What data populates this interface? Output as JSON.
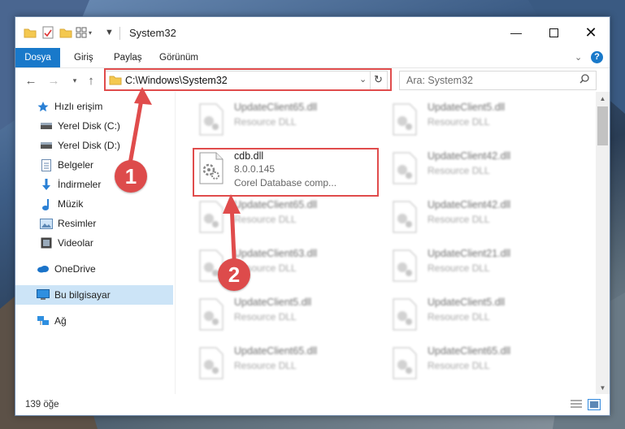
{
  "window": {
    "title": "System32"
  },
  "ribbon": {
    "tabs": [
      "Dosya",
      "Giriş",
      "Paylaş",
      "Görünüm"
    ]
  },
  "address": {
    "path": "C:\\Windows\\System32"
  },
  "search": {
    "placeholder": "Ara: System32"
  },
  "nav": {
    "quick_access": "Hızlı erişim",
    "items": [
      "Yerel Disk (C:)",
      "Yerel Disk (D:)",
      "Belgeler",
      "İndirmeler",
      "Müzik",
      "Resimler",
      "Videolar"
    ],
    "onedrive": "OneDrive",
    "this_pc": "Bu bilgisayar",
    "network": "Ağ"
  },
  "files": {
    "left": [
      {
        "name": "UpdateClient65.dll",
        "type": "Resource DLL"
      },
      {
        "name": "cdb.dll",
        "version": "8.0.0.145",
        "desc": "Corel Database comp..."
      },
      {
        "name": "UpdateClient65.dll",
        "type": "Resource DLL"
      },
      {
        "name": "UpdateClient63.dll",
        "type": "Resource DLL"
      },
      {
        "name": "UpdateClient5.dll",
        "type": "Resource DLL"
      },
      {
        "name": "UpdateClient65.dll",
        "type": "Resource DLL"
      }
    ],
    "right": [
      {
        "name": "UpdateClient5.dll",
        "type": "Resource DLL"
      },
      {
        "name": "UpdateClient42.dll",
        "type": "Resource DLL"
      },
      {
        "name": "UpdateClient42.dll",
        "type": "Resource DLL"
      },
      {
        "name": "UpdateClient21.dll",
        "type": "Resource DLL"
      },
      {
        "name": "UpdateClient5.dll",
        "type": "Resource DLL"
      },
      {
        "name": "UpdateClient65.dll",
        "type": "Resource DLL"
      }
    ]
  },
  "status": {
    "count": "139 öğe"
  },
  "annotations": {
    "badge1": "1",
    "badge2": "2",
    "color": "#dd4b4b"
  }
}
